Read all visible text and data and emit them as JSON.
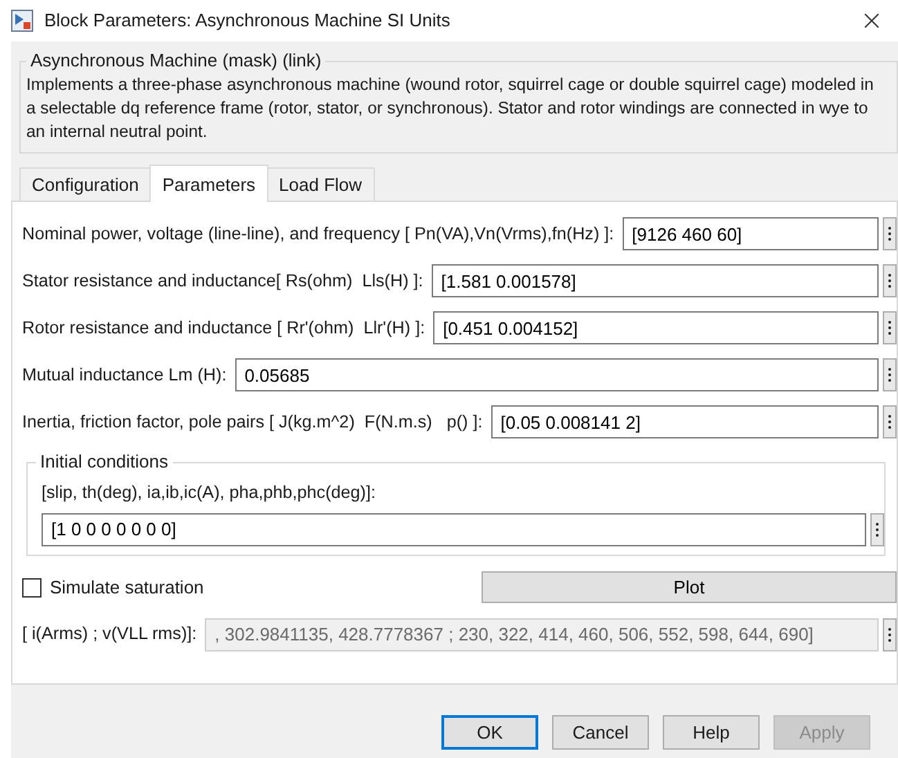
{
  "window": {
    "title": "Block Parameters: Asynchronous Machine SI Units"
  },
  "mask": {
    "title": "Asynchronous Machine (mask) (link)",
    "description": "Implements a three-phase asynchronous machine (wound rotor, squirrel cage or double squirrel cage) modeled in a selectable dq reference frame (rotor, stator, or synchronous). Stator and rotor windings are connected in wye to an internal neutral point."
  },
  "tabs": [
    {
      "label": "Configuration",
      "selected": false
    },
    {
      "label": "Parameters",
      "selected": true
    },
    {
      "label": "Load Flow",
      "selected": false
    }
  ],
  "parameters": [
    {
      "label": "Nominal power, voltage (line-line), and frequency [ Pn(VA),Vn(Vrms),fn(Hz) ]:",
      "value": "[9126 460 60]"
    },
    {
      "label": "Stator resistance and inductance[ Rs(ohm)  Lls(H) ]:",
      "value": "[1.581 0.001578]"
    },
    {
      "label": "Rotor resistance and inductance [ Rr'(ohm)  Llr'(H) ]:",
      "value": "[0.451 0.004152]"
    },
    {
      "label": "Mutual inductance Lm (H):",
      "value": "0.05685"
    },
    {
      "label": "Inertia, friction factor, pole pairs [ J(kg.m^2)  F(N.m.s)   p() ]:",
      "value": "[0.05 0.008141 2]"
    }
  ],
  "initial_conditions": {
    "title": "Initial conditions",
    "label": "[slip, th(deg), ia,ib,ic(A), pha,phb,phc(deg)]:",
    "value": "[1 0 0 0 0 0 0 0]"
  },
  "simulate_saturation": {
    "label": "Simulate saturation",
    "checked": false
  },
  "plot_button": "Plot",
  "saturation": {
    "label": "[ i(Arms) ; v(VLL rms)]:",
    "value": ", 302.9841135, 428.7778367 ; 230, 322, 414, 460, 506, 552, 598, 644, 690]",
    "disabled": true
  },
  "buttons": [
    {
      "label": "OK",
      "default": true,
      "disabled": false
    },
    {
      "label": "Cancel",
      "default": false,
      "disabled": false
    },
    {
      "label": "Help",
      "default": false,
      "disabled": false
    },
    {
      "label": "Apply",
      "default": false,
      "disabled": true
    }
  ]
}
